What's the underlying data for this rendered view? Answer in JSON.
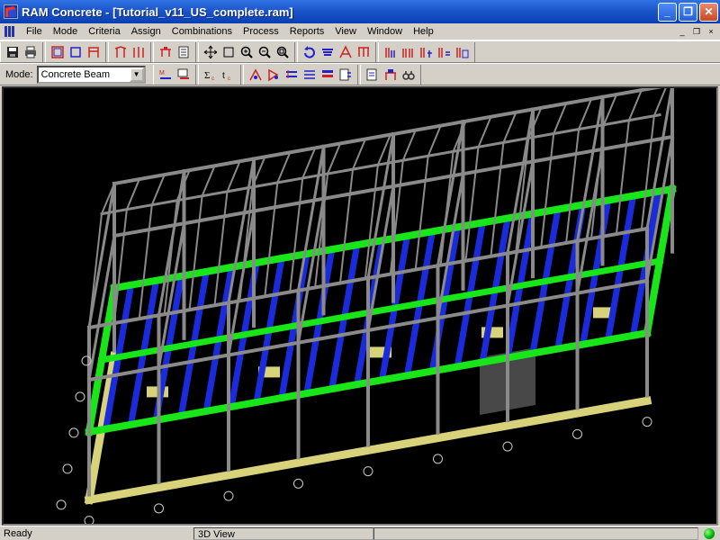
{
  "window": {
    "title": "RAM Concrete - [Tutorial_v11_US_complete.ram]",
    "minimize_icon": "minimize-icon",
    "maximize_icon": "restore-icon",
    "close_icon": "close-icon"
  },
  "menu": {
    "items": [
      "File",
      "Mode",
      "Criteria",
      "Assign",
      "Combinations",
      "Process",
      "Reports",
      "View",
      "Window",
      "Help"
    ],
    "mdi_buttons": [
      "_",
      "❐",
      "×"
    ]
  },
  "toolbar": {
    "mode_label": "Mode:",
    "mode_value": "Concrete Beam"
  },
  "statusbar": {
    "ready": "Ready",
    "view": "3D View",
    "indicator_color": "#00aa00"
  },
  "colors": {
    "frame": "#8a8a8a",
    "girder_green": "#19e619",
    "joist_blue": "#1a2bdc",
    "footing_yellow": "#d8d27a",
    "wall_gray": "#5a5a5a"
  }
}
